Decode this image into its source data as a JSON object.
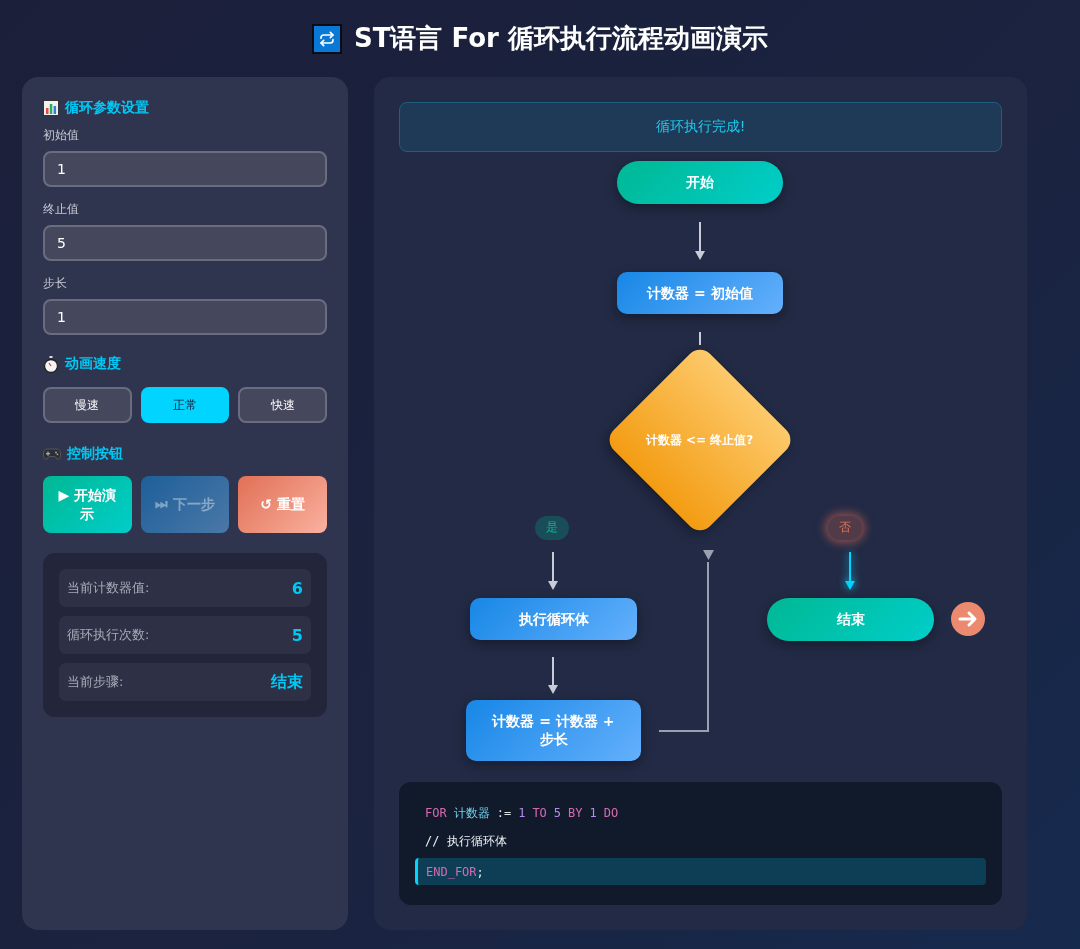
{
  "title": {
    "text": "ST语言 For 循环执行流程动画演示"
  },
  "params": {
    "heading": "循环参数设置",
    "fields": [
      {
        "label": "初始值",
        "value": "1"
      },
      {
        "label": "终止值",
        "value": "5"
      },
      {
        "label": "步长",
        "value": "1"
      }
    ]
  },
  "speed": {
    "heading": "动画速度",
    "options": [
      {
        "label": "慢速",
        "selected": false
      },
      {
        "label": "正常",
        "selected": true
      },
      {
        "label": "快速",
        "selected": false
      }
    ]
  },
  "controls": {
    "heading": "控制按钮",
    "buttons": [
      {
        "kind": "start",
        "label": "▶ 开始演示",
        "disabled": false
      },
      {
        "kind": "step",
        "label": "⏭ 下一步",
        "disabled": true
      },
      {
        "kind": "reset",
        "label": "↺ 重置",
        "disabled": false
      }
    ]
  },
  "stats": [
    {
      "label": "当前计数器值:",
      "value": "6"
    },
    {
      "label": "循环执行次数:",
      "value": "5"
    },
    {
      "label": "当前步骤:",
      "value": "结束"
    }
  ],
  "flow": {
    "message": "循环执行完成!",
    "nodes": [
      {
        "kind": "terminal",
        "text": "开始",
        "current": false
      },
      {
        "kind": "process",
        "text": "计数器 = 初始值",
        "current": false
      },
      {
        "kind": "decision",
        "text": "计数器 <= 终止值?",
        "current": false
      },
      {
        "kind": "process",
        "text": "执行循环体",
        "current": false
      },
      {
        "kind": "process",
        "text": "计数器 = 计数器 + 步长",
        "current": false
      },
      {
        "kind": "terminal",
        "text": "结束",
        "current": true
      }
    ],
    "branches": [
      {
        "kind": "yes",
        "label": "是",
        "taken": false
      },
      {
        "kind": "no",
        "label": "否",
        "taken": true
      }
    ]
  },
  "code": {
    "lines": [
      {
        "highlighted": false,
        "tokens": [
          {
            "kind": "keyword",
            "text": "FOR"
          },
          {
            "kind": "ident",
            "text": "计数器"
          },
          {
            "kind": "op",
            "text": ":="
          },
          {
            "kind": "number",
            "text": "1"
          },
          {
            "kind": "keyword",
            "text": "TO"
          },
          {
            "kind": "number",
            "text": "5"
          },
          {
            "kind": "keyword",
            "text": "BY"
          },
          {
            "kind": "number",
            "text": "1"
          },
          {
            "kind": "keyword",
            "text": "DO"
          }
        ]
      },
      {
        "highlighted": false,
        "tokens": [
          {
            "kind": "comment",
            "text": "// 执行循环体"
          }
        ]
      },
      {
        "highlighted": true,
        "tokens": [
          {
            "kind": "keyword",
            "text": "END_FOR"
          },
          {
            "kind": "op",
            "text": ";"
          }
        ]
      }
    ]
  }
}
